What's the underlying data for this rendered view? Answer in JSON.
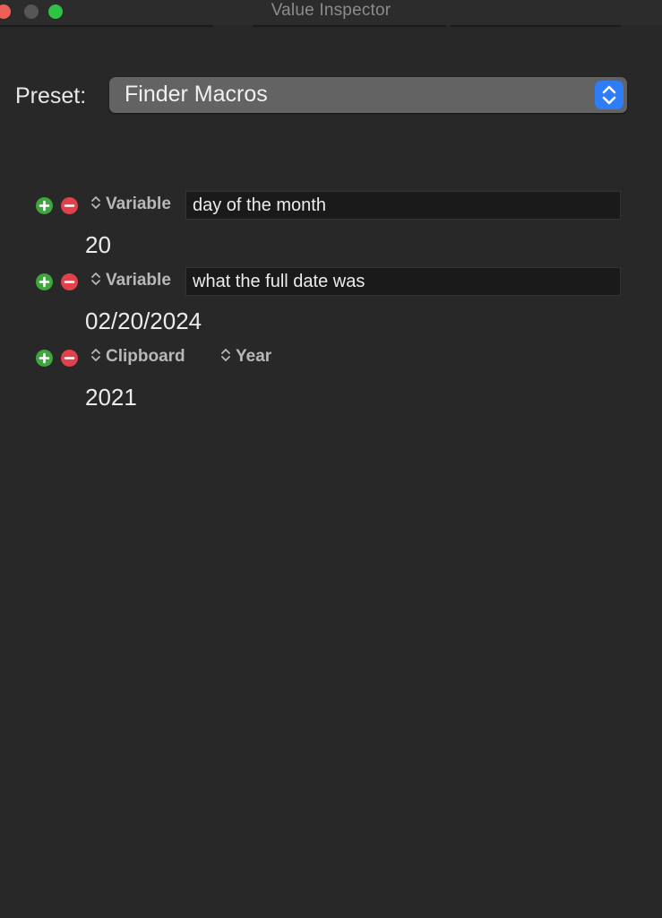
{
  "window": {
    "title": "Value Inspector"
  },
  "preset": {
    "label": "Preset:",
    "selected": "Finder Macros"
  },
  "rows": [
    {
      "source": "Variable",
      "input_value": "day of the month",
      "value": "20"
    },
    {
      "source": "Variable",
      "input_value": "what the full date was",
      "value": "02/20/2024"
    },
    {
      "source": "Clipboard",
      "secondary": "Year",
      "value": "2021"
    }
  ],
  "colors": {
    "background": "#282828",
    "add": "#3fa63f",
    "remove": "#e0414b",
    "accent": "#2e7cf6"
  },
  "icons": {
    "add": "plus-circle-icon",
    "remove": "minus-circle-icon",
    "selector": "up-down-chevron-icon"
  }
}
